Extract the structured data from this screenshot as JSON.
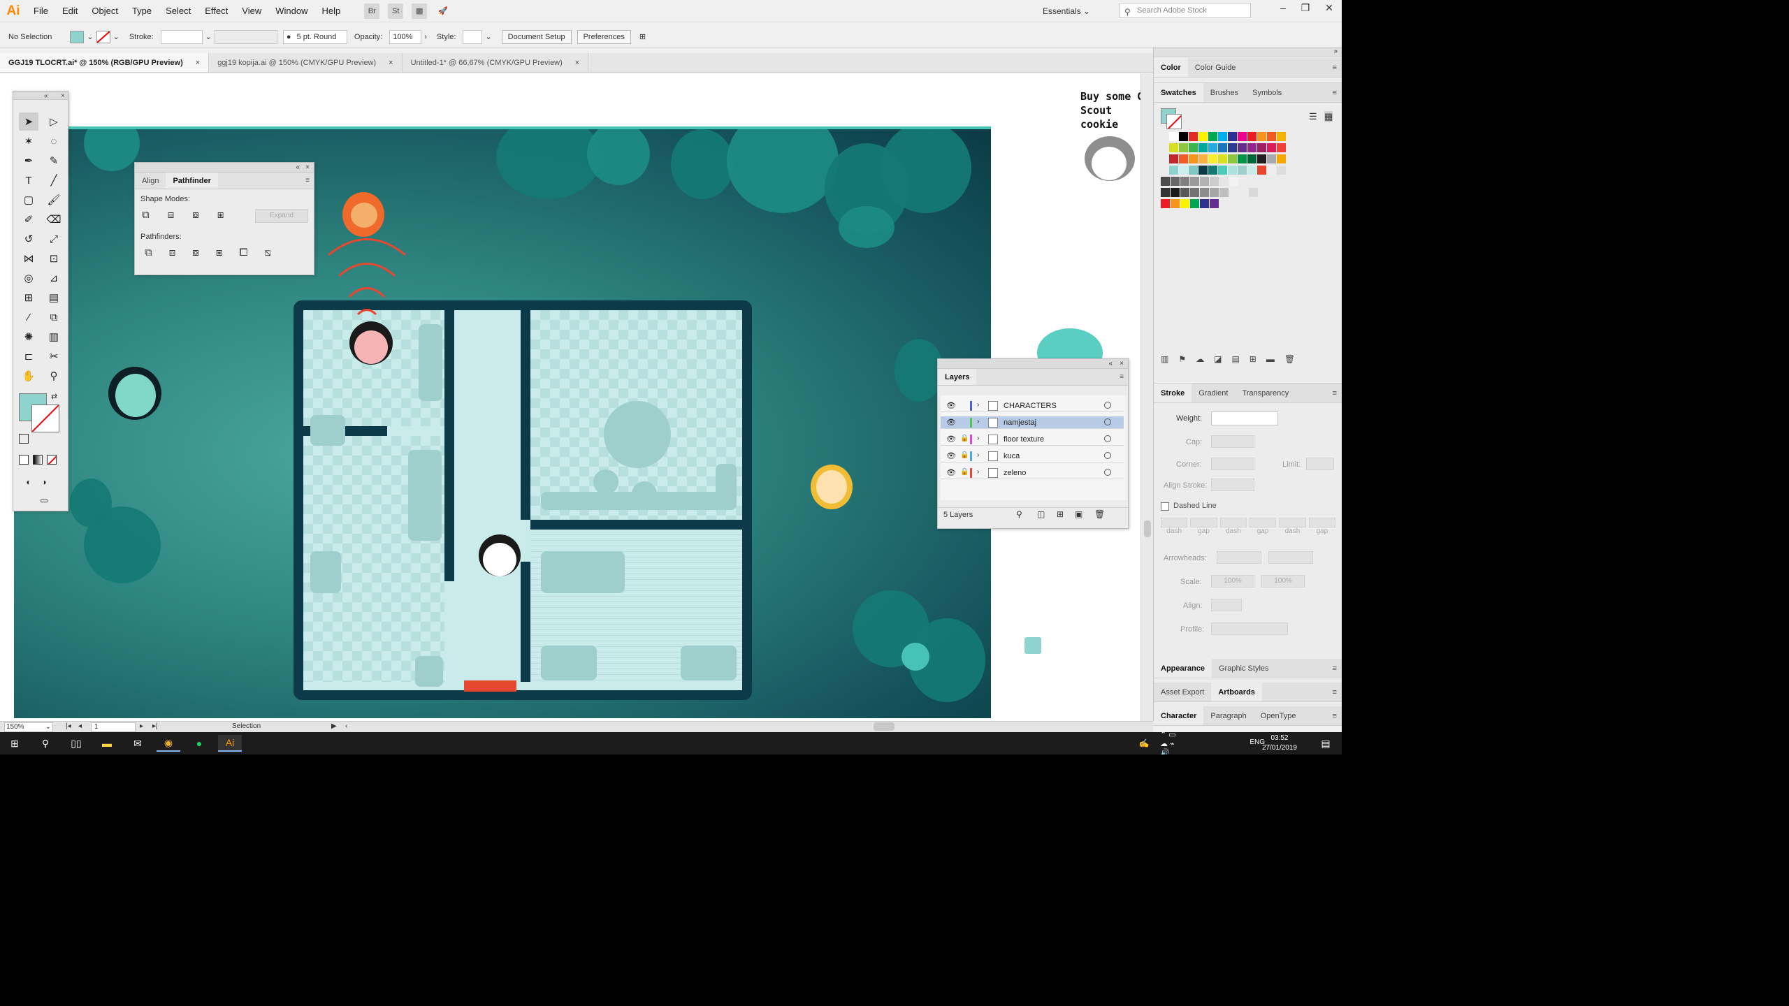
{
  "menubar": {
    "logo": "Ai",
    "items": [
      "File",
      "Edit",
      "Object",
      "Type",
      "Select",
      "Effect",
      "View",
      "Window",
      "Help"
    ],
    "workspace": "Essentials",
    "search_placeholder": "Search Adobe Stock"
  },
  "controlbar": {
    "selection": "No Selection",
    "stroke_label": "Stroke:",
    "brush": "5 pt. Round",
    "opacity_label": "Opacity:",
    "opacity_value": "100%",
    "style_label": "Style:",
    "document_setup": "Document Setup",
    "preferences": "Preferences"
  },
  "doctabs": [
    {
      "label": "GGJ19 TLOCRT.ai* @ 150% (RGB/GPU Preview)",
      "active": true
    },
    {
      "label": "ggj19 kopija.ai @ 150% (CMYK/GPU Preview)",
      "active": false
    },
    {
      "label": "Untitled-1* @ 66,67% (CMYK/GPU Preview)",
      "active": false
    }
  ],
  "artboard_text": {
    "line1": "Buy some G",
    "line2": "Scout cookie"
  },
  "pathfinder_panel": {
    "tabs": [
      "Align",
      "Pathfinder"
    ],
    "active_tab": "Pathfinder",
    "shape_modes_label": "Shape Modes:",
    "expand_label": "Expand",
    "pathfinders_label": "Pathfinders:"
  },
  "layers_panel": {
    "title": "Layers",
    "layers": [
      {
        "name": "CHARACTERS",
        "color": "#4a63d8",
        "locked": false,
        "selected": false
      },
      {
        "name": "namjestaj",
        "color": "#52c84f",
        "locked": false,
        "selected": true
      },
      {
        "name": "floor texture",
        "color": "#d94be0",
        "locked": true,
        "selected": false
      },
      {
        "name": "kuca",
        "color": "#4aa9e0",
        "locked": true,
        "selected": false
      },
      {
        "name": "zeleno",
        "color": "#e84a3a",
        "locked": true,
        "selected": false
      }
    ],
    "footer": "5 Layers"
  },
  "right_dock": {
    "color_tabs": [
      "Color",
      "Color Guide"
    ],
    "swatch_tabs": [
      "Swatches",
      "Brushes",
      "Symbols"
    ],
    "stroke_tabs": [
      "Stroke",
      "Gradient",
      "Transparency"
    ],
    "weight_label": "Weight:",
    "cap_label": "Cap:",
    "corner_label": "Corner:",
    "limit_label": "Limit:",
    "align_stroke_label": "Align Stroke:",
    "dashed_line_label": "Dashed Line",
    "dash_labels": [
      "dash",
      "gap",
      "dash",
      "gap",
      "dash",
      "gap"
    ],
    "arrowheads_label": "Arrowheads:",
    "scale_label": "Scale:",
    "scale_values": [
      "100%",
      "100%"
    ],
    "align_label": "Align:",
    "profile_label": "Profile:",
    "appearance_tabs": [
      "Appearance",
      "Graphic Styles"
    ],
    "export_tabs": [
      "Asset Export",
      "Artboards"
    ],
    "character_tabs": [
      "Character",
      "Paragraph",
      "OpenType"
    ]
  },
  "statusbar": {
    "zoom": "150%",
    "artboard": "1",
    "tool": "Selection"
  },
  "taskbar": {
    "lang": "ENG",
    "time": "03:52",
    "date": "27/01/2019"
  },
  "colors": {
    "accent_teal": "#2e857f",
    "wall": "#0c3a48",
    "floor": "#c9ebea",
    "door_red": "#e8472f"
  }
}
